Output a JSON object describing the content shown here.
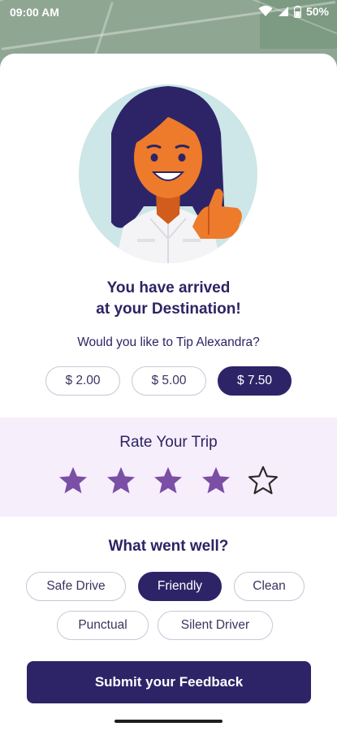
{
  "status_bar": {
    "time": "09:00 AM",
    "battery": "50%"
  },
  "arrival": {
    "title_line1": "You have arrived",
    "title_line2": "at your Destination!",
    "tip_prompt": "Would you like to Tip Alexandra?"
  },
  "tips": [
    {
      "label": "$ 2.00",
      "selected": false
    },
    {
      "label": "$ 5.00",
      "selected": false
    },
    {
      "label": "$ 7.50",
      "selected": true
    }
  ],
  "rating": {
    "title": "Rate Your Trip",
    "value": 4,
    "max": 5
  },
  "feedback": {
    "title": "What went well?",
    "options": [
      {
        "label": "Safe Drive",
        "selected": false
      },
      {
        "label": "Friendly",
        "selected": true
      },
      {
        "label": "Clean",
        "selected": false
      },
      {
        "label": "Punctual",
        "selected": false
      },
      {
        "label": "Silent Driver",
        "selected": false
      }
    ]
  },
  "submit_label": "Submit your Feedback",
  "colors": {
    "primary": "#2d2468",
    "star": "#7b4fa6",
    "rate_bg": "#f6eefb"
  }
}
